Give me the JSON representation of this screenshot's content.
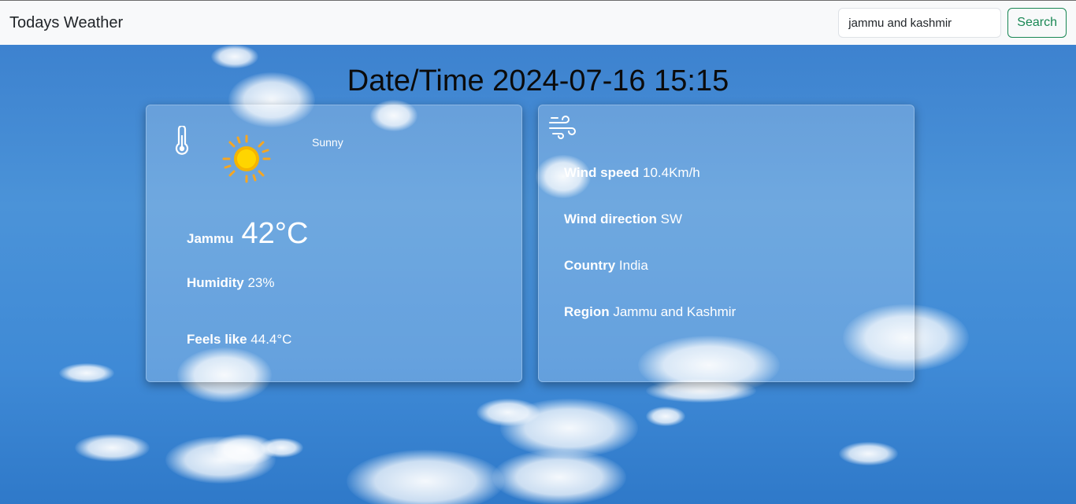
{
  "navbar": {
    "brand": "Todays Weather",
    "search_value": "jammu and kashmir",
    "search_button": "Search"
  },
  "datetime": "Date/Time 2024-07-16 15:15",
  "weather": {
    "condition": "Sunny",
    "condition_icon": "sun-icon",
    "city": "Jammu",
    "temperature": "42°C",
    "humidity_label": "Humidity",
    "humidity_value": "23%",
    "feels_label": "Feels like",
    "feels_value": "44.4°C"
  },
  "wind": {
    "speed_label": "Wind speed",
    "speed_value": "10.4Km/h",
    "direction_label": "Wind direction",
    "direction_value": "SW",
    "country_label": "Country",
    "country_value": "India",
    "region_label": "Region",
    "region_value": "Jammu and Kashmir"
  },
  "colors": {
    "accent": "#198754",
    "navbar_bg": "#f8f9fa",
    "sky": "#3f86d4"
  }
}
